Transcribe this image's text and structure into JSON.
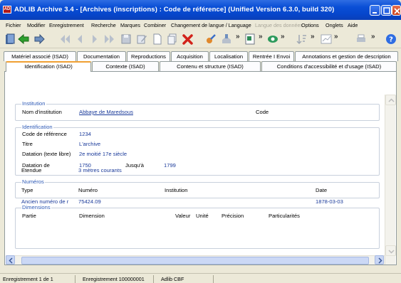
{
  "window": {
    "app_logo": "AD",
    "title": "ADLIB Archive 3.4 - [Archives (inscriptions) : Code de référence] (Unified Version 6.3.0, build 320)"
  },
  "menu": [
    {
      "label": "Fichier",
      "enabled": true
    },
    {
      "label": "Modifier",
      "enabled": true
    },
    {
      "label": "Enregistrement",
      "enabled": true
    },
    {
      "label": "Recherche",
      "enabled": true
    },
    {
      "label": "Marques",
      "enabled": true
    },
    {
      "label": "Combiner",
      "enabled": true
    },
    {
      "label": "Changement de langue / Language",
      "enabled": true
    },
    {
      "label": "Langue des données",
      "enabled": false
    },
    {
      "label": "Options",
      "enabled": true
    },
    {
      "label": "Onglets",
      "enabled": true
    },
    {
      "label": "Aide",
      "enabled": true
    }
  ],
  "toolbar": {
    "overflow_glyph": "»",
    "buttons": [
      "app-icon",
      "back-icon",
      "forward-icon",
      "first-icon",
      "previous-icon",
      "next-icon",
      "last-icon",
      "save-icon",
      "edit-icon",
      "new-icon",
      "copy-icon",
      "delete-icon",
      "link-icon",
      "import-icon",
      "form-icon",
      "view-icon",
      "sort-icon",
      "chart-icon",
      "print-icon",
      "help-icon"
    ]
  },
  "tabs": {
    "row1": [
      "Matériel associé (ISAD)",
      "Documentation",
      "Reproductions",
      "Acquisition",
      "Localisation",
      "Rentrée I Envoi",
      "Annotations et gestion de description"
    ],
    "row2": [
      "Identification (ISAD)",
      "Contexte (ISAD)",
      "Contenu et structure (ISAD)",
      "Conditions d'accessibilité et d'usage (ISAD)"
    ],
    "active": "Identification (ISAD)"
  },
  "form": {
    "institution": {
      "title": "Institution",
      "name_label": "Nom d'institution",
      "name_value": "Abbaye de Maredsous",
      "code_label": "Code"
    },
    "identification": {
      "title": "Identification",
      "ref_label": "Code de référence",
      "ref_value": "1234",
      "titre_label": "Titre",
      "titre_value": "L'archive",
      "datation_text_label": "Datation (texte libre)",
      "datation_text_value": "2e moitié 17e siècle",
      "datation_label": "Datation de",
      "datation_from": "1750",
      "jusqua_label": "Jusqu'à",
      "datation_to": "1799",
      "etendue_label": "Etendue",
      "etendue_value": "3 mètres courants"
    },
    "numeros": {
      "title": "Numéros",
      "headers": [
        "Type",
        "Numéro",
        "Institution",
        "Date"
      ],
      "row": {
        "type": "Ancien numéro de r",
        "numero": "75424.09",
        "institution": "",
        "date": "1878-03-03"
      }
    },
    "dimensions": {
      "title": "Dimensions",
      "headers": [
        "Partie",
        "Dimension",
        "Valeur",
        "Unité",
        "Précision",
        "Particularités"
      ]
    }
  },
  "status": {
    "record": "Enregistrement 1 de 1",
    "record_id": "Enregistrement 100000001",
    "db": "Adlib CBF"
  },
  "colors": {
    "title_bar": "#0a4fd6",
    "tab_active_accent": "#f0a033",
    "group_title": "#2f5bb7",
    "field_value": "#1a3a9a"
  }
}
